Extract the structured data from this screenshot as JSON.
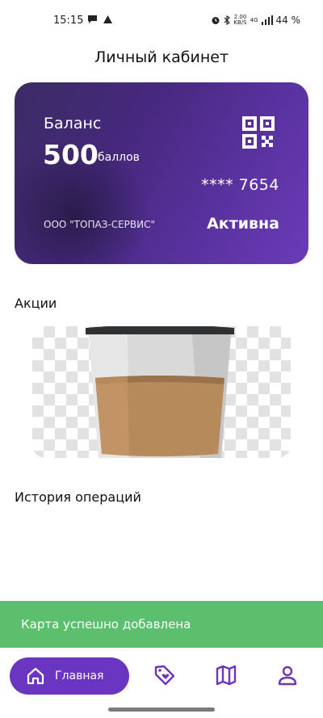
{
  "status_bar": {
    "time": "15:15",
    "net_speed_top": "2.00",
    "net_speed_bottom": "KB/S",
    "network": "4G",
    "battery": "44 %",
    "icons": [
      "message-icon",
      "wifi-triangle-icon",
      "alarm-icon",
      "bluetooth-icon",
      "signal-icon"
    ]
  },
  "header": {
    "title": "Личный кабинет"
  },
  "card": {
    "balance_label": "Баланс",
    "balance_value": "500",
    "balance_unit": "баллов",
    "card_number": "**** 7654",
    "company": "ООО \"ТОПАЗ-СЕРВИС\"",
    "status": "Активна",
    "qr_icon": "qr-code-icon",
    "gradient_colors": [
      "#3b2c63",
      "#6b3bb8"
    ]
  },
  "promos": {
    "title": "Акции",
    "banner_icon": "coffee-cup-image"
  },
  "history": {
    "title": "История операций"
  },
  "toast": {
    "text": "Карта успешно добавлена",
    "color": "#5bbf6e"
  },
  "bottom_nav": {
    "home_label": "Главная",
    "accent_color": "#6a35c0",
    "items": [
      {
        "icon": "home-icon",
        "active": true
      },
      {
        "icon": "tag-heart-icon",
        "active": false
      },
      {
        "icon": "map-icon",
        "active": false
      },
      {
        "icon": "profile-icon",
        "active": false
      }
    ]
  }
}
